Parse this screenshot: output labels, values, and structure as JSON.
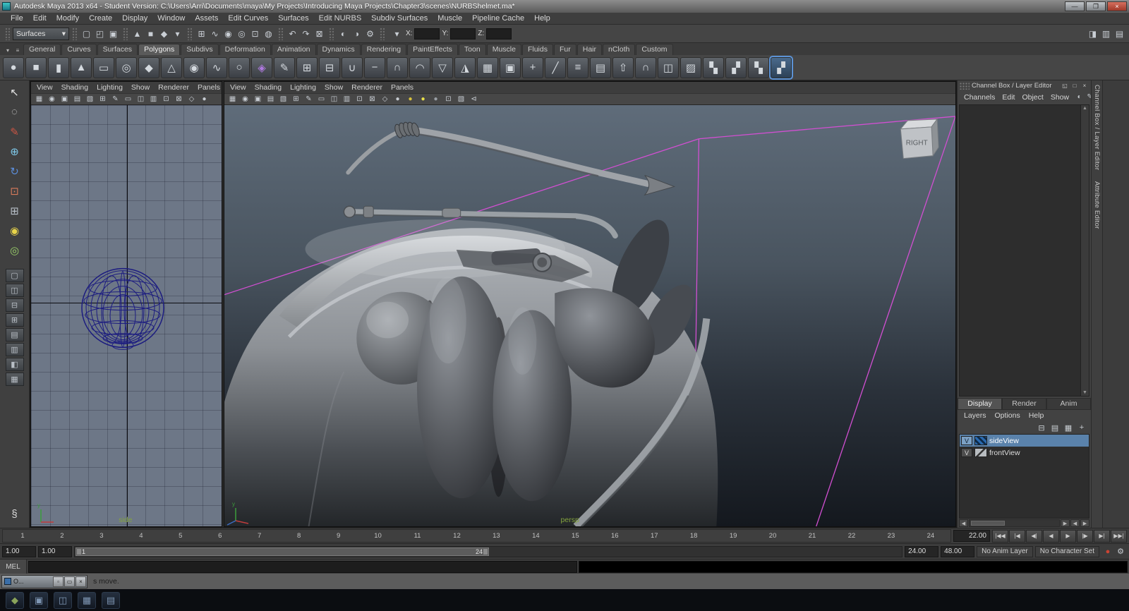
{
  "colors": {
    "selection_blue": "#5a82ab",
    "frustum_magenta": "#d24fd2",
    "viewport_gradient_top": "#5f6c7a",
    "viewport_gradient_bottom": "#14181e",
    "ortho_background": "#6d7787",
    "wireframe_blue": "#1c1c80",
    "camera_label_green": "#84a43e"
  },
  "window": {
    "title": "Autodesk Maya 2013 x64 - Student Version: C:\\Users\\Arri\\Documents\\maya\\My Projects\\Introducing Maya Projects\\Chapter3\\scenes\\NURBShelmet.ma*",
    "minimize": "—",
    "maximize": "❐",
    "close": "×"
  },
  "menubar": [
    "File",
    "Edit",
    "Modify",
    "Create",
    "Display",
    "Window",
    "Assets",
    "Edit Curves",
    "Surfaces",
    "Edit NURBS",
    "Subdiv Surfaces",
    "Muscle",
    "Pipeline Cache",
    "Help"
  ],
  "statusline": {
    "mode": "Surfaces",
    "mode_arrow": "▾",
    "file_icons": [
      {
        "name": "scene-new-icon",
        "glyph": "▢"
      },
      {
        "name": "scene-open-icon",
        "glyph": "◰"
      },
      {
        "name": "scene-save-icon",
        "glyph": "▣"
      }
    ],
    "select_icons": [
      {
        "name": "select-hierarchy-icon",
        "glyph": "▲"
      },
      {
        "name": "select-object-icon",
        "glyph": "■"
      },
      {
        "name": "select-component-icon",
        "glyph": "◆"
      },
      {
        "name": "selection-mask-dropdown-icon",
        "glyph": "▾"
      }
    ],
    "snap_icons": [
      {
        "name": "snap-grid-icon",
        "glyph": "⊞"
      },
      {
        "name": "snap-curve-icon",
        "glyph": "∿"
      },
      {
        "name": "snap-point-icon",
        "glyph": "◉"
      },
      {
        "name": "snap-projected-center-icon",
        "glyph": "◎"
      },
      {
        "name": "snap-view-plane-icon",
        "glyph": "⊡"
      },
      {
        "name": "make-live-icon",
        "glyph": "◍"
      }
    ],
    "history_icons": [
      {
        "name": "input-connections-icon",
        "glyph": "↶"
      },
      {
        "name": "output-connections-icon",
        "glyph": "↷"
      },
      {
        "name": "construction-history-icon",
        "glyph": "⊠"
      }
    ],
    "render_icons": [
      {
        "name": "render-current-frame-icon",
        "glyph": "◐"
      },
      {
        "name": "ipr-render-icon",
        "glyph": "◑"
      },
      {
        "name": "render-settings-icon",
        "glyph": "⚙"
      }
    ],
    "coords": {
      "selector_arrow": "▾",
      "x_label": "X:",
      "x_value": "",
      "y_label": "Y:",
      "y_value": "",
      "z_label": "Z:",
      "z_value": ""
    },
    "right_icons": [
      {
        "name": "show-channel-box-icon",
        "glyph": "◨"
      },
      {
        "name": "show-layer-bar-icon",
        "glyph": "▥"
      },
      {
        "name": "show-attribute-editor-icon",
        "glyph": "▤"
      }
    ]
  },
  "shelf": {
    "tab_controls": [
      {
        "name": "shelf-tab-menu-icon",
        "glyph": "▾"
      },
      {
        "name": "shelf-menu-icon",
        "glyph": "≡"
      }
    ],
    "tabs": [
      {
        "label": "General"
      },
      {
        "label": "Curves"
      },
      {
        "label": "Surfaces"
      },
      {
        "label": "Polygons",
        "active": true
      },
      {
        "label": "Subdivs"
      },
      {
        "label": "Deformation"
      },
      {
        "label": "Animation"
      },
      {
        "label": "Dynamics"
      },
      {
        "label": "Rendering"
      },
      {
        "label": "PaintEffects"
      },
      {
        "label": "Toon"
      },
      {
        "label": "Muscle"
      },
      {
        "label": "Fluids"
      },
      {
        "label": "Fur"
      },
      {
        "label": "Hair"
      },
      {
        "label": "nCloth"
      },
      {
        "label": "Custom"
      }
    ],
    "icons": [
      {
        "name": "shelf-poly-sphere",
        "glyph": "●"
      },
      {
        "name": "shelf-poly-cube",
        "glyph": "■"
      },
      {
        "name": "shelf-poly-cylinder",
        "glyph": "▮"
      },
      {
        "name": "shelf-poly-cone",
        "glyph": "▲"
      },
      {
        "name": "shelf-poly-plane",
        "glyph": "▭"
      },
      {
        "name": "shelf-poly-torus",
        "glyph": "◎"
      },
      {
        "name": "shelf-poly-prism",
        "glyph": "◆"
      },
      {
        "name": "shelf-poly-pyramid",
        "glyph": "△"
      },
      {
        "name": "shelf-poly-pipe",
        "glyph": "◉"
      },
      {
        "name": "shelf-poly-helix",
        "glyph": "∿"
      },
      {
        "name": "shelf-poly-soccer-ball",
        "glyph": "○"
      },
      {
        "name": "shelf-poly-platonic-solid",
        "glyph": "◈",
        "color": "#b07ae0"
      },
      {
        "name": "shelf-sculpt-geometry",
        "glyph": "✎"
      },
      {
        "name": "shelf-combine",
        "glyph": "⊞"
      },
      {
        "name": "shelf-separate",
        "glyph": "⊟"
      },
      {
        "name": "shelf-boolean-union",
        "glyph": "∪"
      },
      {
        "name": "shelf-boolean-difference",
        "glyph": "−"
      },
      {
        "name": "shelf-boolean-intersection",
        "glyph": "∩"
      },
      {
        "name": "shelf-smooth",
        "glyph": "◠"
      },
      {
        "name": "shelf-reduce",
        "glyph": "▽"
      },
      {
        "name": "shelf-triangulate",
        "glyph": "◮"
      },
      {
        "name": "shelf-quadrangulate",
        "glyph": "▦"
      },
      {
        "name": "shelf-fill-hole",
        "glyph": "▣"
      },
      {
        "name": "shelf-append-polygon",
        "glyph": "+"
      },
      {
        "name": "shelf-split-polygon",
        "glyph": "╱"
      },
      {
        "name": "shelf-insert-edge-loop",
        "glyph": "≡"
      },
      {
        "name": "shelf-offset-edge-loop",
        "glyph": "▤"
      },
      {
        "name": "shelf-extrude",
        "glyph": "⇧"
      },
      {
        "name": "shelf-bridge",
        "glyph": "∩"
      },
      {
        "name": "shelf-mirror-geometry",
        "glyph": "◫"
      },
      {
        "name": "shelf-uv-planar-map",
        "glyph": "▨"
      },
      {
        "name": "shelf-uv-checker-1",
        "glyph": "▚"
      },
      {
        "name": "shelf-uv-checker-2",
        "glyph": "▞"
      },
      {
        "name": "shelf-uv-checker-3",
        "glyph": "▚"
      },
      {
        "name": "shelf-uv-checker-4",
        "glyph": "▞",
        "active": true
      }
    ]
  },
  "toolbox": {
    "tools": [
      {
        "name": "select-tool",
        "glyph": "↖",
        "color": "#e8e8e8"
      },
      {
        "name": "lasso-select-tool",
        "glyph": "◌",
        "color": "#e0e0e0"
      },
      {
        "name": "paint-selection-tool",
        "glyph": "✎",
        "color": "#cc5544"
      },
      {
        "name": "move-tool",
        "glyph": "⊕",
        "color": "#7ec8e8"
      },
      {
        "name": "rotate-tool",
        "glyph": "↻",
        "color": "#5b8dd9"
      },
      {
        "name": "scale-tool",
        "glyph": "⊡",
        "color": "#d97b5b"
      },
      {
        "name": "universal-manipulator-tool",
        "glyph": "⊞",
        "color": "#b8c0c8"
      },
      {
        "name": "soft-modification-tool",
        "glyph": "◉",
        "color": "#e8d44a"
      },
      {
        "name": "show-manipulator-tool",
        "glyph": "◎",
        "color": "#9ad06a"
      }
    ],
    "layouts": [
      {
        "name": "layout-single-pane",
        "glyph": "▢"
      },
      {
        "name": "layout-two-side-by-side",
        "glyph": "◫"
      },
      {
        "name": "layout-two-stacked",
        "glyph": "⊟"
      },
      {
        "name": "layout-four-view",
        "glyph": "⊞"
      },
      {
        "name": "layout-three-split-top",
        "glyph": "▤"
      },
      {
        "name": "layout-three-split-left",
        "glyph": "▥"
      },
      {
        "name": "layout-outliner-persp",
        "glyph": "◧"
      },
      {
        "name": "layout-hypergraph-persp",
        "glyph": "▦"
      }
    ],
    "bottom": [
      {
        "name": "toolbox-extra-icon",
        "glyph": "§"
      }
    ]
  },
  "viewport": {
    "menus": [
      "View",
      "Shading",
      "Lighting",
      "Show",
      "Renderer",
      "Panels"
    ],
    "toolbar_icons": [
      {
        "name": "select-camera-icon",
        "glyph": "▦"
      },
      {
        "name": "lock-camera-icon",
        "glyph": "◉"
      },
      {
        "name": "camera-attributes-icon",
        "glyph": "▣"
      },
      {
        "name": "bookmark-icon",
        "glyph": "▤"
      },
      {
        "name": "image-plane-icon",
        "glyph": "▧"
      },
      {
        "name": "2d-pan-zoom-icon",
        "glyph": "⊞"
      },
      {
        "name": "grease-pencil-icon",
        "glyph": "✎"
      },
      {
        "name": "film-gate-icon",
        "glyph": "▭"
      },
      {
        "name": "resolution-gate-icon",
        "glyph": "◫"
      },
      {
        "name": "gate-mask-icon",
        "glyph": "▥"
      },
      {
        "name": "safe-action-icon",
        "glyph": "⊡"
      },
      {
        "name": "safe-title-icon",
        "glyph": "⊠"
      },
      {
        "name": "wireframe-mode-icon",
        "glyph": "◇"
      },
      {
        "name": "shaded-mode-icon",
        "glyph": "●"
      }
    ],
    "toolbar_icons_extra": [
      {
        "name": "default-lighting-icon",
        "glyph": "●",
        "color": "#d8c23c"
      },
      {
        "name": "all-lights-icon",
        "glyph": "●",
        "color": "#e8e04a"
      },
      {
        "name": "no-lights-icon",
        "glyph": "●",
        "color": "#9aa0a6"
      },
      {
        "name": "isolate-select-icon",
        "glyph": "⊡"
      },
      {
        "name": "xray-icon",
        "glyph": "▧"
      },
      {
        "name": "plugin-shapes-icon",
        "glyph": "⊲"
      }
    ],
    "left_camera_label": "side",
    "right_camera_label": "persp",
    "viewcube_label": "RIGHT"
  },
  "channelbox": {
    "title": "Channel Box / Layer Editor",
    "corner_icons": [
      {
        "name": "float-panel-icon",
        "glyph": "◱"
      },
      {
        "name": "maximize-panel-icon",
        "glyph": "□"
      },
      {
        "name": "close-panel-icon",
        "glyph": "×"
      }
    ],
    "menus": [
      "Channels",
      "Edit",
      "Object",
      "Show"
    ],
    "manip_icons": [
      {
        "name": "slow-manip-icon",
        "glyph": "◐"
      },
      {
        "name": "manip-attribute-icon",
        "glyph": "✎"
      },
      {
        "name": "hyperbolic-spread-icon",
        "glyph": "◉"
      }
    ],
    "scroll_up": "▲",
    "scroll_down": "▼"
  },
  "layer_editor": {
    "tabs": [
      {
        "label": "Display",
        "active": true
      },
      {
        "label": "Render"
      },
      {
        "label": "Anim"
      }
    ],
    "menus": [
      "Layers",
      "Options",
      "Help"
    ],
    "icons": [
      {
        "name": "move-to-layer-icon",
        "glyph": "⊟"
      },
      {
        "name": "new-empty-layer-icon",
        "glyph": "▤"
      },
      {
        "name": "new-layer-from-selected-icon",
        "glyph": "▦"
      },
      {
        "name": "new-layer-icon",
        "glyph": "+"
      }
    ],
    "layers": [
      {
        "visible": "V",
        "name": "sideView",
        "selected": true
      },
      {
        "visible": "V",
        "name": "frontView",
        "selected": false
      }
    ],
    "scroll_left": "◀",
    "scroll_right": "▶"
  },
  "side_tabs": [
    "Channel Box / Layer Editor",
    "Attribute Editor"
  ],
  "timeline": {
    "ticks": [
      "1",
      "2",
      "3",
      "4",
      "5",
      "6",
      "7",
      "8",
      "9",
      "10",
      "11",
      "12",
      "13",
      "14",
      "15",
      "16",
      "17",
      "18",
      "19",
      "20",
      "21",
      "22",
      "23",
      "24"
    ],
    "current": "22.00",
    "playback": [
      {
        "name": "go-to-start-button",
        "glyph": "|◀◀"
      },
      {
        "name": "step-back-frame-button",
        "glyph": "|◀"
      },
      {
        "name": "step-back-key-button",
        "glyph": "◀|"
      },
      {
        "name": "play-backwards-button",
        "glyph": "◀"
      },
      {
        "name": "play-forwards-button",
        "glyph": "▶"
      },
      {
        "name": "step-forward-key-button",
        "glyph": "|▶"
      },
      {
        "name": "step-forward-frame-button",
        "glyph": "▶|"
      },
      {
        "name": "go-to-end-button",
        "glyph": "▶▶|"
      }
    ]
  },
  "range": {
    "anim_start": "1.00",
    "playback_start": "1.00",
    "range_start_label": "1",
    "range_end_label": "24",
    "playback_end": "24.00",
    "anim_end": "48.00",
    "anim_layer": "No Anim Layer",
    "character_set": "No Character Set",
    "right_icons": [
      {
        "name": "auto-keyframe-button",
        "glyph": "●",
        "color": "#cc4433"
      },
      {
        "name": "animation-preferences-icon",
        "glyph": "⚙"
      }
    ]
  },
  "cmdline": {
    "label": "MEL"
  },
  "helpline": {
    "mini_title": "O...",
    "mini_buttons": [
      "▫",
      "▭",
      "×"
    ],
    "text": "s move."
  },
  "taskbar": {
    "icons": [
      {
        "name": "taskbar-start-button",
        "glyph": "◆",
        "color": "#8aa45a"
      },
      {
        "name": "taskbar-app-1",
        "glyph": "▣"
      },
      {
        "name": "taskbar-app-2",
        "glyph": "◫"
      },
      {
        "name": "taskbar-app-3",
        "glyph": "▦"
      },
      {
        "name": "taskbar-app-4",
        "glyph": "▤"
      }
    ]
  }
}
